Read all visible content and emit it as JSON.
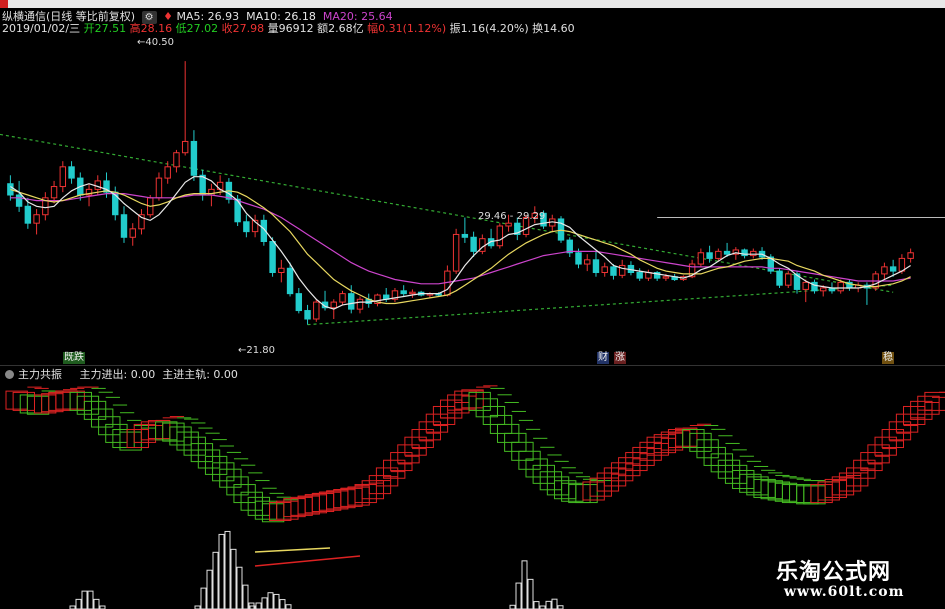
{
  "header": {
    "stock_name": "纵横通信(日线 等比前复权)",
    "ma5_label": "MA5:",
    "ma5_value": "26.93",
    "ma10_label": "MA10:",
    "ma10_value": "26.18",
    "ma20_label": "MA20:",
    "ma20_value": "25.64",
    "date": "2019/01/02/三",
    "open_label": "开",
    "open": "27.51",
    "high_label": "高",
    "high": "28.16",
    "low_label": "低",
    "low": "27.02",
    "close_label": "收",
    "close": "27.98",
    "volume_label": "量",
    "volume": "96912",
    "amount_label": "额",
    "amount": "2.68亿",
    "change_label": "幅",
    "change": "0.31(1.12%)",
    "amplitude_label": "振",
    "amplitude": "1.16(4.20%)",
    "turnover_label": "换",
    "turnover": "14.60"
  },
  "annotations": {
    "high_price": "40.50",
    "low_price": "21.80",
    "line_label": "29.46 - 29.29",
    "tag_1": "既跌",
    "tag_2": "财",
    "tag_3": "涨",
    "tag_4": "稳"
  },
  "indicator": {
    "name": "主力共振",
    "line1_label": "主力进出:",
    "line1_value": "0.00",
    "line2_label": "主进主轨:",
    "line2_value": "0.00"
  },
  "watermark": {
    "title": "乐淘公式网",
    "url": "www.60lt.com"
  },
  "colors": {
    "up": "#ee3333",
    "down": "#22cccc",
    "ma5": "#e8e8e8",
    "ma10": "#e8d860",
    "ma20": "#cc44cc",
    "trend": "#33aa33",
    "ind_up": "#dd2222",
    "ind_down": "#44bb22"
  },
  "chart_data": [
    {
      "type": "candlestick",
      "name": "price",
      "ylim": [
        20,
        42
      ],
      "candles": [
        [
          31.8,
          32.4,
          30.6,
          31.0
        ],
        [
          31.0,
          32.0,
          29.8,
          30.2
        ],
        [
          30.2,
          30.8,
          28.6,
          29.0
        ],
        [
          29.0,
          30.0,
          28.2,
          29.6
        ],
        [
          29.6,
          31.2,
          29.2,
          30.8
        ],
        [
          30.8,
          32.0,
          30.4,
          31.6
        ],
        [
          31.6,
          33.4,
          31.2,
          33.0
        ],
        [
          33.0,
          33.4,
          31.8,
          32.2
        ],
        [
          32.2,
          32.6,
          30.6,
          31.0
        ],
        [
          31.0,
          31.8,
          30.2,
          31.4
        ],
        [
          31.4,
          32.4,
          31.0,
          32.0
        ],
        [
          32.0,
          32.6,
          30.8,
          31.2
        ],
        [
          31.2,
          31.6,
          29.2,
          29.6
        ],
        [
          29.6,
          30.2,
          27.6,
          28.0
        ],
        [
          28.0,
          29.0,
          27.4,
          28.6
        ],
        [
          28.6,
          30.0,
          28.2,
          29.6
        ],
        [
          29.6,
          31.0,
          29.4,
          30.8
        ],
        [
          30.8,
          32.6,
          30.6,
          32.2
        ],
        [
          32.2,
          33.4,
          31.8,
          33.0
        ],
        [
          33.0,
          34.2,
          32.6,
          34.0
        ],
        [
          34.0,
          40.5,
          33.8,
          34.8
        ],
        [
          34.8,
          35.6,
          32.0,
          32.4
        ],
        [
          32.4,
          32.8,
          30.6,
          31.0
        ],
        [
          31.0,
          31.8,
          30.2,
          31.4
        ],
        [
          31.4,
          32.4,
          31.0,
          31.9
        ],
        [
          31.9,
          32.2,
          30.4,
          30.7
        ],
        [
          30.7,
          31.0,
          28.8,
          29.1
        ],
        [
          29.1,
          29.6,
          28.0,
          28.4
        ],
        [
          28.4,
          29.6,
          28.0,
          29.2
        ],
        [
          29.2,
          29.6,
          27.4,
          27.7
        ],
        [
          27.7,
          28.0,
          25.2,
          25.5
        ],
        [
          25.5,
          26.4,
          24.8,
          25.8
        ],
        [
          25.8,
          26.2,
          23.8,
          24.0
        ],
        [
          24.0,
          24.4,
          22.6,
          22.8
        ],
        [
          22.8,
          23.2,
          21.8,
          22.2
        ],
        [
          22.2,
          23.6,
          22.0,
          23.4
        ],
        [
          23.4,
          24.2,
          22.8,
          23.0
        ],
        [
          23.0,
          23.6,
          22.2,
          23.4
        ],
        [
          23.4,
          24.2,
          23.2,
          24.0
        ],
        [
          24.0,
          24.6,
          22.6,
          22.9
        ],
        [
          22.9,
          23.8,
          22.6,
          23.6
        ],
        [
          23.6,
          24.0,
          23.0,
          23.3
        ],
        [
          23.3,
          24.0,
          23.1,
          23.9
        ],
        [
          23.9,
          24.4,
          23.4,
          23.6
        ],
        [
          23.6,
          24.4,
          23.4,
          24.2
        ],
        [
          24.2,
          24.6,
          23.8,
          24.0
        ],
        [
          24.0,
          24.3,
          23.7,
          24.1
        ],
        [
          24.1,
          24.2,
          23.8,
          23.9
        ],
        [
          23.9,
          24.1,
          23.7,
          24.0
        ],
        [
          24.0,
          24.1,
          23.8,
          23.9
        ],
        [
          23.9,
          26.0,
          23.8,
          25.6
        ],
        [
          25.6,
          28.6,
          25.4,
          28.2
        ],
        [
          28.2,
          29.4,
          27.6,
          28.0
        ],
        [
          28.0,
          28.4,
          26.6,
          27.0
        ],
        [
          27.0,
          28.2,
          26.8,
          27.9
        ],
        [
          27.9,
          28.6,
          27.2,
          27.4
        ],
        [
          27.4,
          29.0,
          27.2,
          28.8
        ],
        [
          28.8,
          29.6,
          28.4,
          29.0
        ],
        [
          29.0,
          29.4,
          27.8,
          28.2
        ],
        [
          28.2,
          29.6,
          28.0,
          29.4
        ],
        [
          29.4,
          30.2,
          29.0,
          29.7
        ],
        [
          29.7,
          29.9,
          28.6,
          28.8
        ],
        [
          28.8,
          29.6,
          28.4,
          29.3
        ],
        [
          29.3,
          29.5,
          27.6,
          27.8
        ],
        [
          27.8,
          28.0,
          26.6,
          26.9
        ],
        [
          26.9,
          27.2,
          25.8,
          26.1
        ],
        [
          26.1,
          26.8,
          25.6,
          26.4
        ],
        [
          26.4,
          27.0,
          25.2,
          25.5
        ],
        [
          25.5,
          26.2,
          25.2,
          25.9
        ],
        [
          25.9,
          26.1,
          25.0,
          25.3
        ],
        [
          25.3,
          26.4,
          25.1,
          26.0
        ],
        [
          26.0,
          26.3,
          25.3,
          25.5
        ],
        [
          25.5,
          25.8,
          24.9,
          25.1
        ],
        [
          25.1,
          25.7,
          24.9,
          25.5
        ],
        [
          25.5,
          25.6,
          24.9,
          25.1
        ],
        [
          25.1,
          25.4,
          24.9,
          25.2
        ],
        [
          25.2,
          25.4,
          24.9,
          25.0
        ],
        [
          25.0,
          25.3,
          24.9,
          25.2
        ],
        [
          25.2,
          26.4,
          25.1,
          26.1
        ],
        [
          26.1,
          27.2,
          25.9,
          26.9
        ],
        [
          26.9,
          27.4,
          26.2,
          26.5
        ],
        [
          26.5,
          27.2,
          26.3,
          27.0
        ],
        [
          27.0,
          27.6,
          26.6,
          26.8
        ],
        [
          26.8,
          27.3,
          26.4,
          27.1
        ],
        [
          27.1,
          27.2,
          26.5,
          26.7
        ],
        [
          26.7,
          27.2,
          26.5,
          27.0
        ],
        [
          27.0,
          27.3,
          26.4,
          26.6
        ],
        [
          26.6,
          26.8,
          25.4,
          25.6
        ],
        [
          25.6,
          25.8,
          24.4,
          24.6
        ],
        [
          24.6,
          25.6,
          24.4,
          25.4
        ],
        [
          25.4,
          25.6,
          24.0,
          24.3
        ],
        [
          24.3,
          25.0,
          23.4,
          24.8
        ],
        [
          24.8,
          25.0,
          24.0,
          24.2
        ],
        [
          24.2,
          24.6,
          23.8,
          24.4
        ],
        [
          24.4,
          24.8,
          24.0,
          24.2
        ],
        [
          24.2,
          25.0,
          24.0,
          24.8
        ],
        [
          24.8,
          25.0,
          24.2,
          24.4
        ],
        [
          24.4,
          24.8,
          24.1,
          24.6
        ],
        [
          24.6,
          24.8,
          23.2,
          24.4
        ],
        [
          24.4,
          25.6,
          24.2,
          25.4
        ],
        [
          25.4,
          26.2,
          25.0,
          25.9
        ],
        [
          25.9,
          26.4,
          25.2,
          25.6
        ],
        [
          25.6,
          26.8,
          25.4,
          26.5
        ],
        [
          26.5,
          27.2,
          26.2,
          26.9
        ]
      ],
      "ma5": [
        31.6,
        31.2,
        30.5,
        30.2,
        30.1,
        30.2,
        30.8,
        31.3,
        31.6,
        31.8,
        31.6,
        31.4,
        31.0,
        30.4,
        29.9,
        29.4,
        29.2,
        29.6,
        30.3,
        31.1,
        31.9,
        32.3,
        32.3,
        32.0,
        31.4,
        31.1,
        30.6,
        29.7,
        29.1,
        28.6,
        27.8,
        27.0,
        26.1,
        25.1,
        24.3,
        23.6,
        23.1,
        22.9,
        23.2,
        23.3,
        23.4,
        23.4,
        23.5,
        23.6,
        23.7,
        23.8,
        23.9,
        24.0,
        24.0,
        24.0,
        24.3,
        25.1,
        26.0,
        26.7,
        27.3,
        27.7,
        27.8,
        28.2,
        28.3,
        28.6,
        28.9,
        29.0,
        29.1,
        29.0,
        28.7,
        28.1,
        27.6,
        27.1,
        26.6,
        26.0,
        25.8,
        25.7,
        25.6,
        25.5,
        25.4,
        25.3,
        25.2,
        25.1,
        25.3,
        25.7,
        25.9,
        26.3,
        26.7,
        26.9,
        26.8,
        26.8,
        26.8,
        26.5,
        26.1,
        25.8,
        25.3,
        24.9,
        24.6,
        24.5,
        24.4,
        24.4,
        24.4,
        24.4,
        24.5,
        24.7,
        25.0,
        25.3,
        25.6,
        26.0
      ],
      "ma10": [
        31.4,
        31.2,
        31.0,
        30.8,
        30.6,
        30.5,
        30.6,
        30.8,
        31.0,
        31.1,
        31.2,
        31.3,
        31.2,
        31.0,
        30.7,
        30.4,
        30.2,
        30.3,
        30.5,
        30.8,
        31.0,
        31.1,
        31.1,
        31.1,
        31.2,
        31.3,
        31.2,
        30.9,
        30.5,
        30.1,
        29.6,
        29.0,
        28.4,
        27.6,
        26.8,
        26.2,
        25.6,
        25.0,
        24.6,
        24.2,
        23.9,
        23.6,
        23.4,
        23.3,
        23.3,
        23.4,
        23.5,
        23.6,
        23.7,
        23.8,
        23.9,
        24.2,
        24.6,
        25.0,
        25.4,
        25.8,
        26.3,
        26.8,
        27.2,
        27.6,
        27.9,
        28.2,
        28.4,
        28.5,
        28.4,
        28.2,
        28.0,
        27.8,
        27.6,
        27.4,
        27.1,
        26.8,
        26.4,
        26.1,
        25.8,
        25.6,
        25.5,
        25.4,
        25.4,
        25.4,
        25.6,
        25.8,
        25.9,
        26.1,
        26.3,
        26.4,
        26.5,
        26.5,
        26.4,
        26.3,
        26.0,
        25.8,
        25.6,
        25.3,
        25.1,
        24.9,
        24.7,
        24.6,
        24.5,
        24.5,
        24.6,
        24.7,
        24.9,
        25.2
      ],
      "ma20": [
        30.8,
        30.8,
        30.7,
        30.6,
        30.6,
        30.6,
        30.6,
        30.7,
        30.8,
        30.9,
        31.0,
        31.1,
        31.1,
        31.1,
        31.0,
        30.9,
        30.8,
        30.8,
        30.8,
        30.8,
        30.9,
        31.0,
        31.0,
        31.0,
        30.9,
        30.8,
        30.6,
        30.4,
        30.2,
        30.0,
        29.7,
        29.4,
        29.0,
        28.6,
        28.2,
        27.8,
        27.4,
        27.0,
        26.6,
        26.2,
        25.9,
        25.6,
        25.4,
        25.2,
        25.0,
        24.9,
        24.8,
        24.7,
        24.7,
        24.7,
        24.8,
        24.9,
        25.0,
        25.1,
        25.3,
        25.5,
        25.7,
        25.9,
        26.1,
        26.3,
        26.5,
        26.7,
        26.8,
        26.9,
        27.0,
        27.0,
        27.0,
        27.0,
        26.9,
        26.8,
        26.7,
        26.6,
        26.5,
        26.4,
        26.3,
        26.2,
        26.1,
        26.0,
        25.9,
        25.9,
        25.9,
        25.9,
        25.9,
        25.9,
        25.9,
        25.9,
        25.9,
        25.8,
        25.8,
        25.7,
        25.6,
        25.5,
        25.4,
        25.3,
        25.2,
        25.1,
        25.0,
        24.9,
        24.9,
        24.9,
        24.9,
        24.9,
        25.0,
        25.1
      ]
    },
    {
      "type": "indicator",
      "name": "主力共振",
      "ylim": [
        0,
        100
      ],
      "values": [
        96,
        95,
        93,
        92,
        93,
        94,
        95,
        96,
        96,
        95,
        92,
        88,
        82,
        76,
        70,
        66,
        64,
        66,
        70,
        72,
        73,
        72,
        71,
        68,
        64,
        60,
        55,
        50,
        45,
        40,
        35,
        29,
        23,
        17,
        13,
        10,
        8,
        9,
        10,
        12,
        13,
        14,
        15,
        16,
        17,
        18,
        19,
        20,
        21,
        23,
        26,
        30,
        36,
        42,
        48,
        54,
        60,
        66,
        72,
        78,
        84,
        89,
        93,
        96,
        97,
        95,
        90,
        84,
        77,
        70,
        63,
        56,
        49,
        43,
        38,
        33,
        29,
        26,
        24,
        23,
        23,
        25,
        28,
        32,
        36,
        40,
        44,
        48,
        52,
        56,
        60,
        62,
        64,
        66,
        67,
        66,
        63,
        58,
        52,
        47,
        42,
        38,
        34,
        31,
        29,
        27,
        26,
        25,
        24,
        23,
        23,
        22,
        22,
        23,
        25,
        27,
        29,
        32,
        36,
        42,
        48,
        54,
        60,
        66,
        72,
        78,
        84,
        88,
        92,
        95
      ],
      "direction": [
        1,
        1,
        -1,
        -1,
        1,
        1,
        1,
        1,
        1,
        -1,
        -1,
        -1,
        -1,
        -1,
        -1,
        -1,
        -1,
        1,
        1,
        1,
        1,
        -1,
        -1,
        -1,
        -1,
        -1,
        -1,
        -1,
        -1,
        -1,
        -1,
        -1,
        -1,
        -1,
        -1,
        -1,
        -1,
        1,
        1,
        1,
        1,
        1,
        1,
        1,
        1,
        1,
        1,
        1,
        1,
        1,
        1,
        1,
        1,
        1,
        1,
        1,
        1,
        1,
        1,
        1,
        1,
        1,
        1,
        1,
        1,
        -1,
        -1,
        -1,
        -1,
        -1,
        -1,
        -1,
        -1,
        -1,
        -1,
        -1,
        -1,
        -1,
        -1,
        -1,
        -1,
        1,
        1,
        1,
        1,
        1,
        1,
        1,
        1,
        1,
        1,
        1,
        1,
        1,
        1,
        -1,
        -1,
        -1,
        -1,
        -1,
        -1,
        -1,
        -1,
        -1,
        -1,
        -1,
        -1,
        -1,
        -1,
        -1,
        -1,
        -1,
        -1,
        1,
        1,
        1,
        1,
        1,
        1,
        1,
        1,
        1,
        1,
        1,
        1,
        1,
        1,
        1,
        1,
        1,
        1
      ],
      "histogram": [
        2,
        1,
        0,
        0,
        0,
        0,
        0,
        0,
        0,
        0,
        0,
        0,
        0,
        0,
        0,
        0,
        0,
        0,
        0,
        0,
        0,
        0,
        0,
        0,
        0,
        0,
        0,
        0,
        0,
        0,
        0,
        0,
        0,
        0,
        0,
        0,
        0,
        0,
        0,
        0,
        0,
        0,
        0,
        0,
        0,
        0,
        0,
        0,
        0,
        0,
        0,
        0,
        0,
        0,
        0,
        0,
        0,
        0,
        0,
        0,
        0,
        0,
        0,
        0,
        0,
        0,
        0,
        0,
        0,
        0,
        0,
        0,
        0,
        0,
        0,
        0,
        0,
        0,
        0,
        0,
        0,
        0,
        0,
        0,
        0,
        0,
        0,
        0,
        0,
        0,
        0,
        0,
        0,
        0,
        0,
        0,
        0,
        0,
        0,
        0,
        0,
        0,
        0,
        0,
        0,
        0,
        0,
        0,
        0,
        0,
        0,
        0,
        0,
        0,
        0,
        0,
        0,
        0,
        0,
        0,
        0,
        0,
        0,
        0,
        0,
        0,
        0,
        0,
        0,
        0,
        0
      ]
    }
  ]
}
